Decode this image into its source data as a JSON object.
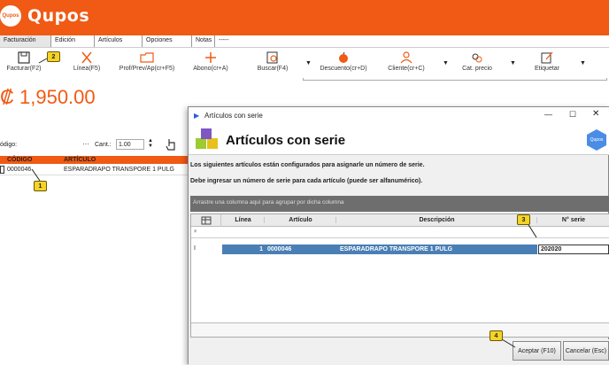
{
  "app": {
    "logo_circle": "Qupos",
    "logo_text": "Qupos"
  },
  "menu": [
    "Facturación",
    "Edición",
    "Artículos",
    "Opciones",
    "Notas",
    "-----"
  ],
  "toolbar": {
    "facturar": "Facturar(F2)",
    "linea": "Línea(F5)",
    "prof": "Prof/Prev/Ap(cr+F5)",
    "abono": "Abono(cr+A)",
    "buscar": "Buscar(F4)",
    "descuento": "Descuento(cr+D)",
    "cliente": "Cliente(cr+C)",
    "cat_precio": "Cat. precio",
    "etiquetar": "Etiquetar"
  },
  "total": "₡ 1,950.00",
  "form": {
    "codigo_label": "ódigo:",
    "cant_label": "Cant.:",
    "cant_value": "1.00"
  },
  "main_grid": {
    "headers": [
      "CÓDIGO",
      "ARTÍCULO"
    ],
    "row": {
      "codigo": "0000046",
      "articulo": "ESPARADRAPO TRANSPORE 1 PULG"
    }
  },
  "dialog": {
    "window_title": "Artículos con serie",
    "title": "Artículos con serie",
    "logo": "Qupos",
    "msg1": "Los siguientes artículos están configurados para asignarle un número de serie.",
    "msg2": "Debe ingresar un número de serie para cada artículo (puede ser alfanumérico).",
    "group_hint": "Arrastre una columna aquí para agrupar por dicha columna",
    "headers": {
      "linea": "Línea",
      "articulo": "Artículo",
      "descripcion": "Descripción",
      "serie": "N° serie"
    },
    "row": {
      "indicator": "I",
      "linea": "1",
      "articulo": "0000046",
      "descripcion": "ESPARADRAPO TRANSPORE 1 PULG",
      "serie": "202020"
    },
    "accept": "Aceptar (F10)",
    "cancel": "Cancelar (Esc)"
  },
  "callouts": [
    "1",
    "2",
    "3",
    "4"
  ],
  "colors": {
    "brand": "#f05a14",
    "selection": "#4a7fb5",
    "callout": "#f5d327"
  }
}
